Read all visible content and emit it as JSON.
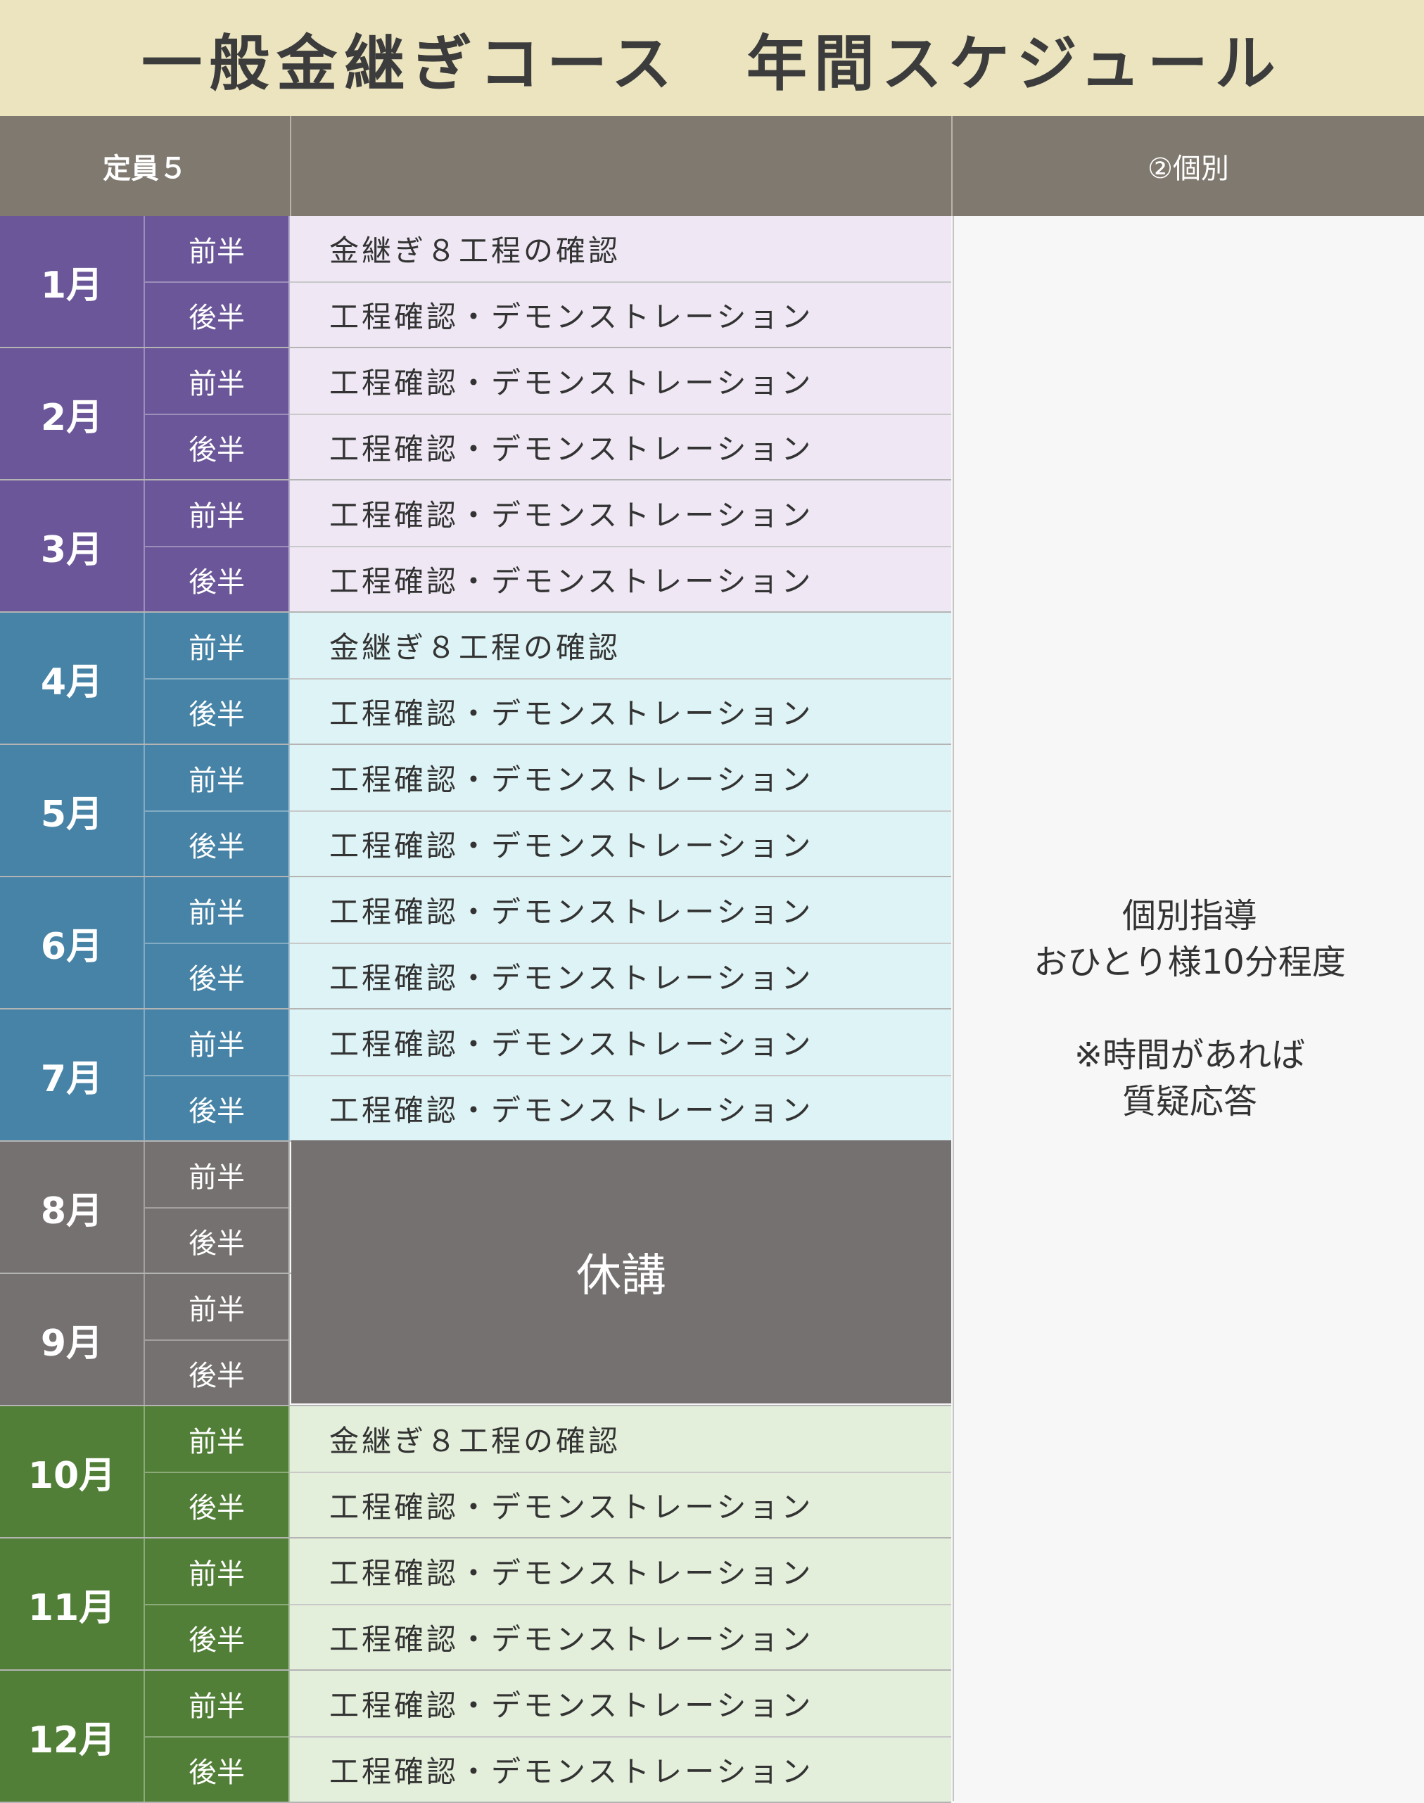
{
  "title": "一般金継ぎコース　年間スケジュール",
  "header": {
    "capacity": "定員５",
    "middle": "",
    "right": "②個別"
  },
  "halves": {
    "first": "前半",
    "second": "後半"
  },
  "months": [
    {
      "label": "1月",
      "items": [
        "金継ぎ８工程の確認",
        "工程確認・デモンストレーション"
      ]
    },
    {
      "label": "2月",
      "items": [
        "工程確認・デモンストレーション",
        "工程確認・デモンストレーション"
      ]
    },
    {
      "label": "3月",
      "items": [
        "工程確認・デモンストレーション",
        "工程確認・デモンストレーション"
      ]
    },
    {
      "label": "4月",
      "items": [
        "金継ぎ８工程の確認",
        "工程確認・デモンストレーション"
      ]
    },
    {
      "label": "5月",
      "items": [
        "工程確認・デモンストレーション",
        "工程確認・デモンストレーション"
      ]
    },
    {
      "label": "6月",
      "items": [
        "工程確認・デモンストレーション",
        "工程確認・デモンストレーション"
      ]
    },
    {
      "label": "7月",
      "items": [
        "工程確認・デモンストレーション",
        "工程確認・デモンストレーション"
      ]
    },
    {
      "label": "8月",
      "items": []
    },
    {
      "label": "9月",
      "items": []
    },
    {
      "label": "10月",
      "items": [
        "金継ぎ８工程の確認",
        "工程確認・デモンストレーション"
      ]
    },
    {
      "label": "11月",
      "items": [
        "工程確認・デモンストレーション",
        "工程確認・デモンストレーション"
      ]
    },
    {
      "label": "12月",
      "items": [
        "工程確認・デモンストレーション",
        "工程確認・デモンストレーション"
      ]
    }
  ],
  "break_label": "休講",
  "individual_note": {
    "line1": "個別指導",
    "line2": "おひとり様10分程度",
    "line3": "※時間があれば",
    "line4": "質疑応答"
  },
  "colors": {
    "q1": "#6a5698",
    "q2": "#4683a6",
    "q3": "#757170",
    "q4": "#527f37",
    "title_bg": "#ebe4bf",
    "header_bg": "#80796f"
  }
}
